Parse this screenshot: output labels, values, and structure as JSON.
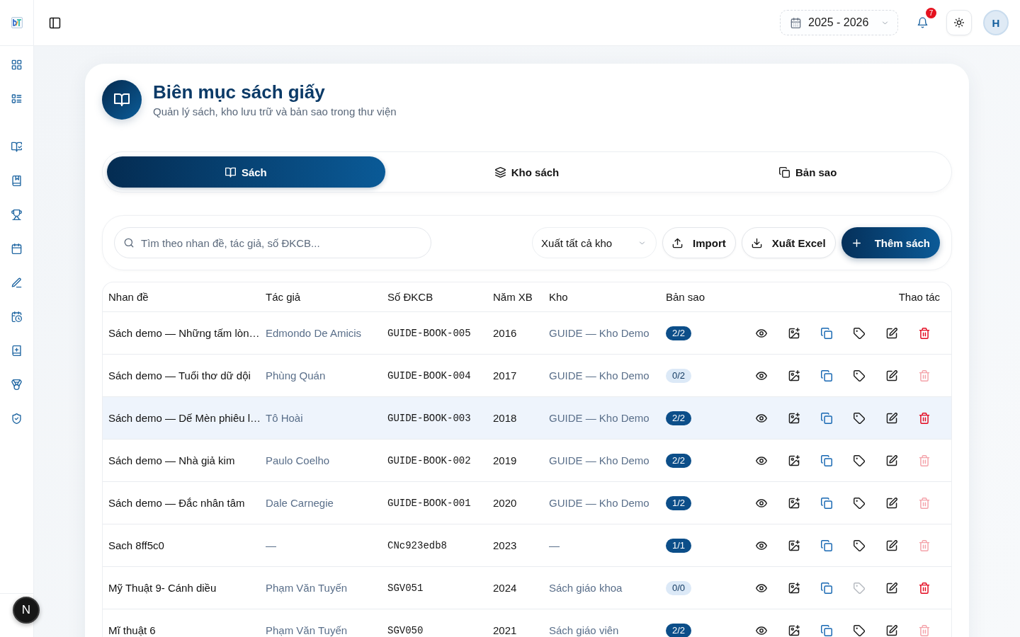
{
  "topbar": {
    "school_year": "2025 - 2026",
    "notification_count": "7",
    "avatar_initial": "H"
  },
  "page_header": {
    "title": "Biên mục sách giấy",
    "subtitle": "Quản lý sách, kho lưu trữ và bản sao trong thư viện"
  },
  "tabs": [
    {
      "label": "Sách",
      "selected": true
    },
    {
      "label": "Kho sách",
      "selected": false
    },
    {
      "label": "Bản sao",
      "selected": false
    }
  ],
  "toolbar": {
    "search": {
      "placeholder": "Tìm theo nhan đề, tác giả, số ĐKCB..."
    },
    "warehouse_filter": "Xuất tất cả kho",
    "buttons": [
      {
        "kind": "import",
        "label": "Import"
      },
      {
        "kind": "export",
        "label": "Xuất Excel"
      },
      {
        "kind": "add",
        "label": "Thêm sách"
      }
    ]
  },
  "table": {
    "columns": [
      "Nhan đề",
      "Tác giả",
      "Số ĐKCB",
      "Năm XB",
      "Kho",
      "Bản sao",
      "Thao tác"
    ],
    "rows": [
      {
        "title": "Sách demo — Những tấm lòn…",
        "author": "Edmondo De Amicis",
        "registration_no": "GUIDE-BOOK-005",
        "year": "2016",
        "warehouse": "GUIDE — Kho Demo",
        "copies": "2/2",
        "copies_available": true,
        "highlighted": false,
        "tag_disabled": false,
        "delete_disabled": false
      },
      {
        "title": "Sách demo — Tuổi thơ dữ dội",
        "author": "Phùng Quán",
        "registration_no": "GUIDE-BOOK-004",
        "year": "2017",
        "warehouse": "GUIDE — Kho Demo",
        "copies": "0/2",
        "copies_available": false,
        "highlighted": false,
        "tag_disabled": false,
        "delete_disabled": true
      },
      {
        "title": "Sách demo — Dế Mèn phiêu l…",
        "author": "Tô Hoài",
        "registration_no": "GUIDE-BOOK-003",
        "year": "2018",
        "warehouse": "GUIDE — Kho Demo",
        "copies": "2/2",
        "copies_available": true,
        "highlighted": true,
        "tag_disabled": false,
        "delete_disabled": false
      },
      {
        "title": "Sách demo — Nhà giả kim",
        "author": "Paulo Coelho",
        "registration_no": "GUIDE-BOOK-002",
        "year": "2019",
        "warehouse": "GUIDE — Kho Demo",
        "copies": "2/2",
        "copies_available": true,
        "highlighted": false,
        "tag_disabled": false,
        "delete_disabled": true
      },
      {
        "title": "Sách demo — Đắc nhân tâm",
        "author": "Dale Carnegie",
        "registration_no": "GUIDE-BOOK-001",
        "year": "2020",
        "warehouse": "GUIDE — Kho Demo",
        "copies": "1/2",
        "copies_available": true,
        "highlighted": false,
        "tag_disabled": false,
        "delete_disabled": true
      },
      {
        "title": "Sach 8ff5c0",
        "author": "—",
        "registration_no": "CNc923edb8",
        "year": "2023",
        "warehouse": "—",
        "copies": "1/1",
        "copies_available": true,
        "highlighted": false,
        "tag_disabled": false,
        "delete_disabled": true
      },
      {
        "title": "Mỹ Thuật 9- Cánh diều",
        "author": "Phạm Văn Tuyến",
        "registration_no": "SGV051",
        "year": "2024",
        "warehouse": "Sách giáo khoa",
        "copies": "0/0",
        "copies_available": false,
        "highlighted": false,
        "tag_disabled": true,
        "delete_disabled": false
      },
      {
        "title": "Mĩ thuật 6",
        "author": "Phạm Văn Tuyến",
        "registration_no": "SGV050",
        "year": "2021",
        "warehouse": "Sách giáo viên",
        "copies": "2/2",
        "copies_available": true,
        "highlighted": false,
        "tag_disabled": false,
        "delete_disabled": true
      }
    ]
  },
  "dev_badge": "N"
}
